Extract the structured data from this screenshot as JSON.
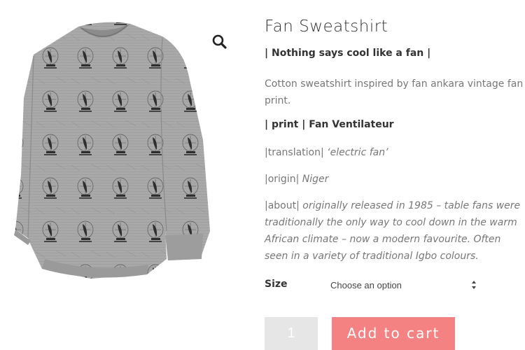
{
  "product": {
    "title": "Fan Sweatshirt",
    "tagline": "| Nothing says cool like a fan |",
    "description": "Cotton sweatshirt inspired by fan ankara vintage fan print.",
    "print_line": "| print | Fan Ventilateur",
    "translation_label": "|translation|",
    "translation_value": "‘electric fan’",
    "origin_label": "|origin|",
    "origin_value": "Niger",
    "about_label": "|about|",
    "about_value": "originally released in 1985 – table fans were traditionally the only way to cool down in the warm African climate – now a modern favourite. Often seen in a variety of traditional Igbo colours."
  },
  "variation": {
    "size_label": "Size",
    "size_placeholder": "Choose an option"
  },
  "cart": {
    "quantity": "1",
    "add_label": "Add to cart"
  },
  "colors": {
    "accent": "#f48282",
    "qty_bg": "#e6e6e6",
    "sweater": "#a9a9a9"
  },
  "icons": {
    "zoom": "magnifier-icon",
    "select_arrows": "up-down-arrows-icon"
  }
}
